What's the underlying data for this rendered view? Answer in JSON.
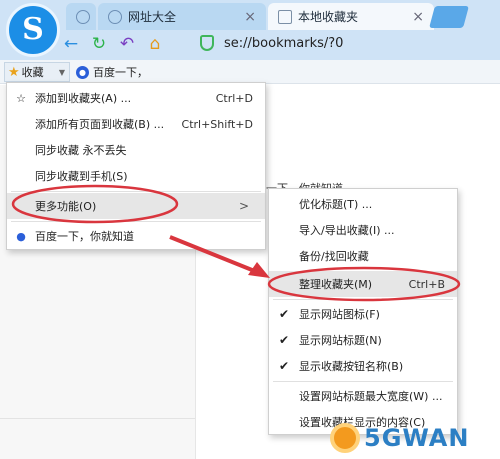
{
  "tabs": [
    {
      "label": "",
      "icon": "sogou-tab-icon"
    },
    {
      "label": "网址大全",
      "icon": "globe-icon"
    },
    {
      "label": "本地收藏夹",
      "icon": "bookmark-page-icon"
    }
  ],
  "tab_close": "×",
  "address": {
    "url": "se://bookmarks/?0"
  },
  "bookmark_bar": {
    "favorites_label": "收藏",
    "baidu_label": "百度一下，"
  },
  "background_text": "度一下，你就知道",
  "menu1": {
    "items": [
      {
        "label": "添加到收藏夹(A) ...",
        "shortcut": "Ctrl+D"
      },
      {
        "label": "添加所有页面到收藏(B) ...",
        "shortcut": "Ctrl+Shift+D"
      },
      {
        "label": "同步收藏 永不丢失",
        "shortcut": ""
      },
      {
        "label": "同步收藏到手机(S)",
        "shortcut": ""
      },
      {
        "label": "更多功能(O)",
        "shortcut": ""
      },
      {
        "label": "百度一下，你就知道",
        "shortcut": ""
      }
    ]
  },
  "menu2": {
    "items": [
      {
        "label": "优化标题(T) ...",
        "shortcut": ""
      },
      {
        "label": "导入/导出收藏(I) ...",
        "shortcut": ""
      },
      {
        "label": "备份/找回收藏",
        "shortcut": ""
      },
      {
        "label": "整理收藏夹(M)",
        "shortcut": "Ctrl+B"
      },
      {
        "label": "显示网站图标(F)",
        "shortcut": ""
      },
      {
        "label": "显示网站标题(N)",
        "shortcut": ""
      },
      {
        "label": "显示收藏按钮名称(B)",
        "shortcut": ""
      },
      {
        "label": "设置网站标题最大宽度(W) ...",
        "shortcut": ""
      },
      {
        "label": "设置收藏栏显示的内容(C)",
        "shortcut": ""
      }
    ]
  },
  "watermark": {
    "brand": "5GWAN"
  },
  "colors": {
    "annotation": "#d9363e",
    "chrome": "#cfe3f6",
    "highlight": "#e6e6e6",
    "check_green": "#3fb65b"
  }
}
